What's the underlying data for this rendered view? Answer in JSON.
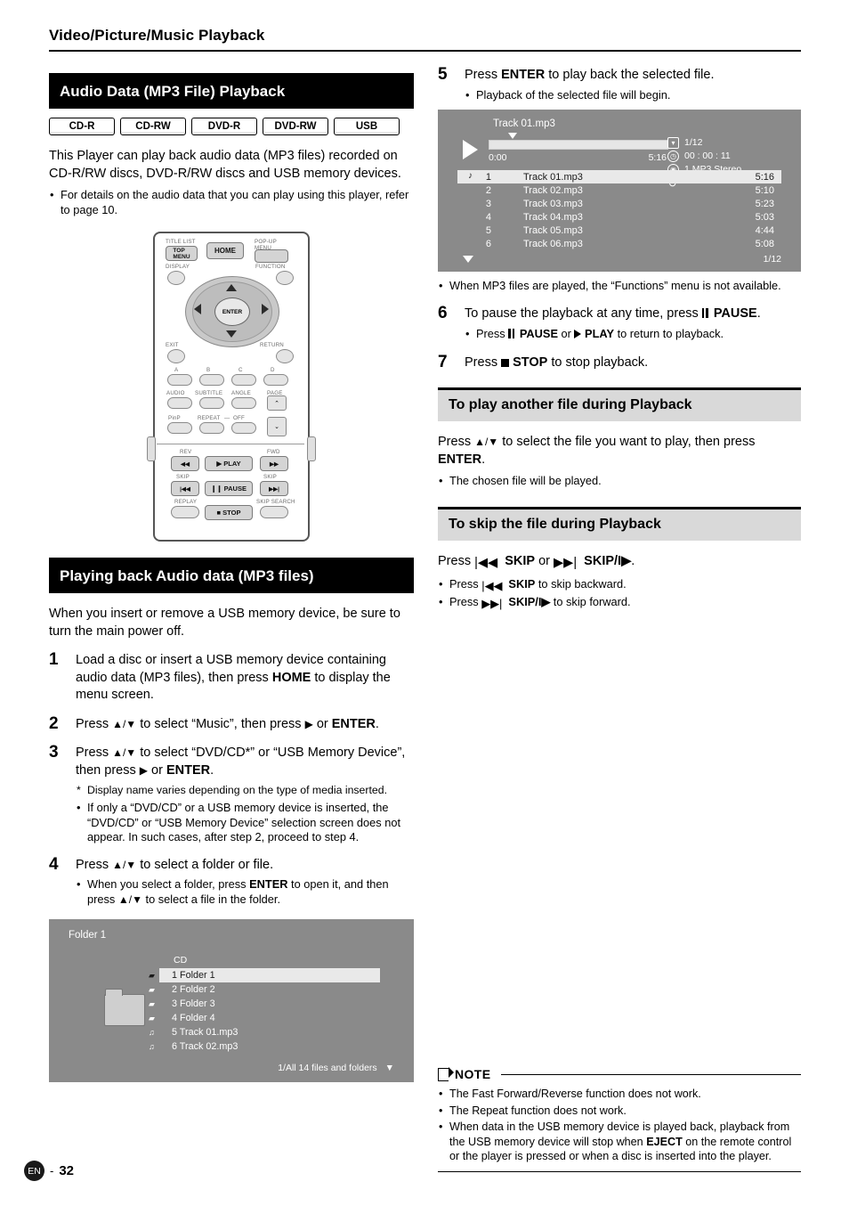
{
  "header": {
    "title": "Video/Picture/Music Playback"
  },
  "left": {
    "section_title": "Audio Data (MP3 File) Playback",
    "chips": [
      "CD-R",
      "CD-RW",
      "DVD-R",
      "DVD-RW",
      "USB"
    ],
    "intro": "This Player can play back audio data (MP3 files) recorded on CD-R/RW discs, DVD-R/RW discs and USB memory devices.",
    "intro_bullets": [
      "For details on the audio data that you can play using this player, refer to page 10."
    ],
    "remote": {
      "labels": [
        "TITLE LIST",
        "TOP MENU",
        "HOME",
        "POP-UP MENU",
        "DISPLAY",
        "FUNCTION",
        "ENTER",
        "EXIT",
        "RETURN",
        "A",
        "B",
        "C",
        "D",
        "AUDIO",
        "SUBTITLE",
        "ANGLE",
        "PAGE",
        "PinP",
        "REPEAT",
        "OFF",
        "REV",
        "FWD",
        "SKIP",
        "SKIP",
        "PLAY",
        "PAUSE",
        "STOP",
        "REPLAY",
        "SKIP SEARCH"
      ],
      "play_label": "PLAY",
      "pause_label": "PAUSE",
      "stop_label": "STOP",
      "enter_label": "ENTER",
      "home_label": "HOME"
    },
    "section2_title": "Playing back Audio data (MP3 files)",
    "section2_intro": "When you insert or remove a USB memory device, be sure to turn the main power off.",
    "steps": [
      {
        "num": "1",
        "html": "Load a disc or insert a USB memory device containing audio data (MP3 files), then press <b>HOME</b> to display the menu screen."
      },
      {
        "num": "2",
        "html": "Press <span class=\"ar\">▲/▼</span> to select &ldquo;Music&rdquo;, then press <span class=\"ar\">▶</span> or <b>ENTER</b>."
      },
      {
        "num": "3",
        "html": "Press <span class=\"ar\">▲/▼</span> to select &ldquo;DVD/CD*&rdquo; or &ldquo;USB Memory Device&rdquo;, then press <span class=\"ar\">▶</span> or <b>ENTER</b>.",
        "star": "Display name varies depending on the type of media inserted.",
        "bullets": [
          "If only a “DVD/CD” or a USB memory device is inserted, the “DVD/CD” or “USB Memory Device” selection screen does not appear. In such cases, after step 2, proceed to step 4."
        ]
      },
      {
        "num": "4",
        "html": "Press <span class=\"ar\">▲/▼</span> to select a folder or file.",
        "bullets": [
          "When you select a folder, press <b>ENTER</b> to open it, and then press <span class=\"ar\">▲/▼</span> to select a file in the folder."
        ]
      }
    ],
    "folder_screen": {
      "title": "Folder 1",
      "source_label": "CD",
      "rows": [
        {
          "icon": "folder",
          "label": "1 Folder 1",
          "selected": true
        },
        {
          "icon": "folder",
          "label": "2 Folder 2",
          "selected": false
        },
        {
          "icon": "folder",
          "label": "3 Folder 3",
          "selected": false
        },
        {
          "icon": "folder",
          "label": "4 Folder 4",
          "selected": false
        },
        {
          "icon": "music",
          "label": "5 Track 01.mp3",
          "selected": false
        },
        {
          "icon": "music",
          "label": "6 Track 02.mp3",
          "selected": false
        }
      ],
      "footer": "1/All 14 files and folders"
    }
  },
  "right": {
    "steps": [
      {
        "num": "5",
        "html": "Press <b>ENTER</b> to play back the selected file.",
        "bullets": [
          "Playback of the selected file will begin."
        ]
      }
    ],
    "play_screen": {
      "now_playing": "Track 01.mp3",
      "time_start": "0:00",
      "time_end": "5:16",
      "info": {
        "track_count": "1/12",
        "elapsed": "00 : 00 : 11",
        "audio": "1  MP3 Stereo",
        "repeat": "–"
      },
      "tracks": [
        {
          "no": "1",
          "name": "Track 01.mp3",
          "time": "5:16",
          "selected": true
        },
        {
          "no": "2",
          "name": "Track 02.mp3",
          "time": "5:10",
          "selected": false
        },
        {
          "no": "3",
          "name": "Track 03.mp3",
          "time": "5:23",
          "selected": false
        },
        {
          "no": "4",
          "name": "Track 04.mp3",
          "time": "5:03",
          "selected": false
        },
        {
          "no": "5",
          "name": "Track 05.mp3",
          "time": "4:44",
          "selected": false
        },
        {
          "no": "6",
          "name": "Track 06.mp3",
          "time": "5:08",
          "selected": false
        }
      ],
      "page_indicator": "1/12"
    },
    "after_screen_bullets": [
      "When MP3 files are played, the “Functions” menu is not available."
    ],
    "steps2": [
      {
        "num": "6",
        "html": "To pause the playback at any time, press <span class=\"pausebar\"><i></i><i></i></span> <b>PAUSE</b>.",
        "bullets_html": [
          "Press <span class=\"pausebar\"><i></i><i></i></span> <b>PAUSE</b> or <span class=\"ptri\"></span> <b>PLAY</b> to return to playback."
        ]
      },
      {
        "num": "7",
        "html": "Press <span class=\"sq\"></span> <b>STOP</b> to stop playback."
      }
    ],
    "section_a_title": "To play another file during Playback",
    "section_a_body_html": "Press <span class=\"ar\">▲/▼</span> to select the file you want to play, then press <b>ENTER</b>.",
    "section_a_bullets": [
      "The chosen file will be played."
    ],
    "section_b_title": "To skip the file during Playback",
    "section_b_body_html": "Press <b>SKIP</b> or <b>SKIP/I▶</b>.",
    "section_b_bullets_html": [
      "Press <b>SKIP</b> to skip backward.",
      "Press <b>SKIP/I▶</b> to skip forward."
    ],
    "note": {
      "label": "NOTE",
      "items_html": [
        "The Fast Forward/Reverse function does not work.",
        "The Repeat function does not work.",
        "When data in the USB memory device is played back, playback from the USB memory device will stop when <b>EJECT</b> on the remote control or the player is pressed or when a disc is inserted into the player."
      ]
    }
  },
  "footer": {
    "lang": "EN",
    "dash": "-",
    "page": "32"
  }
}
